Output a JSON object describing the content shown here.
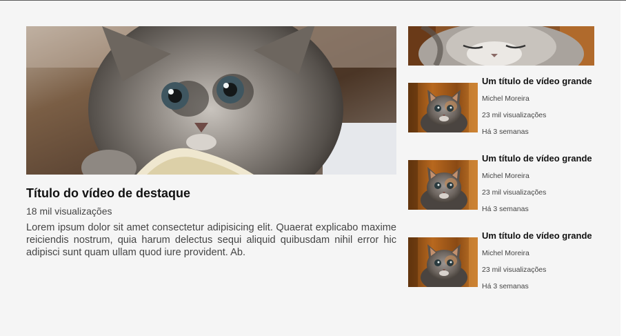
{
  "featured": {
    "title": "Título do vídeo de destaque",
    "views": "18 mil visualizações",
    "description": "Lorem ipsum dolor sit amet consectetur adipisicing elit. Quaerat explicabo maxime reiciendis nostrum, quia harum delectus sequi aliquid quibusdam nihil error hic adipisci sunt quam ullam quod iure provident. Ab."
  },
  "sidebar": {
    "videos": [
      {
        "title": "Um título de vídeo grande",
        "author": "Michel Moreira",
        "views": "23 mil visualizações",
        "age": "Há 3 semanas"
      },
      {
        "title": "Um título de vídeo grande",
        "author": "Michel Moreira",
        "views": "23 mil visualizações",
        "age": "Há 3 semanas"
      },
      {
        "title": "Um título de vídeo grande",
        "author": "Michel Moreira",
        "views": "23 mil visualizações",
        "age": "Há 3 semanas"
      }
    ]
  },
  "colors": {
    "page_background": "#f5f5f5",
    "title_text": "#111111",
    "meta_text": "#444444"
  },
  "icons": {
    "featured_thumbnail": "kitten-photo",
    "sidebar_banner": "sleeping-kitten-photo",
    "video_thumbnail": "kitten-photo"
  }
}
